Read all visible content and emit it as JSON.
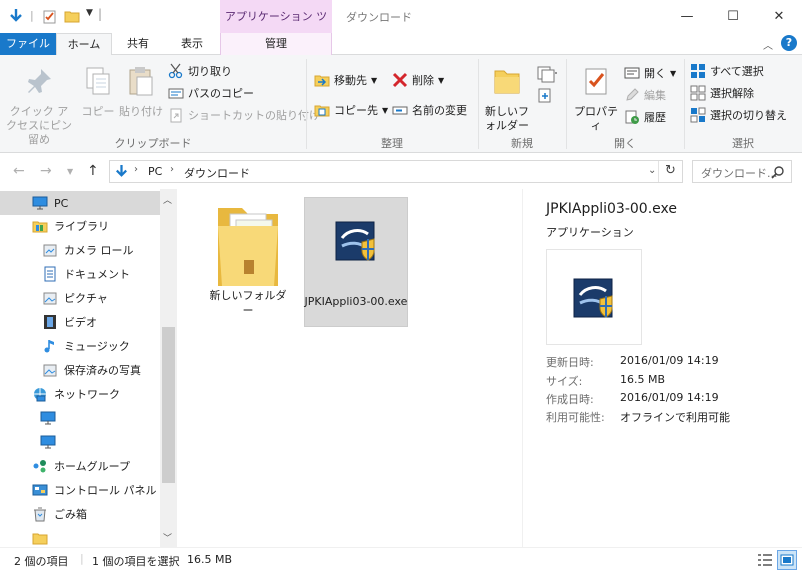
{
  "window": {
    "title": "ダウンロード",
    "context_tab_header": "アプリケーション ツール",
    "min_glyph": "—",
    "max_glyph": "☐",
    "close_glyph": "✕"
  },
  "ribbon_tabs": {
    "file": "ファイル",
    "home": "ホーム",
    "share": "共有",
    "view": "表示",
    "manage": "管理"
  },
  "clipboard": {
    "pin": "クイック アクセスにピン留め",
    "copy": "コピー",
    "paste": "貼り付け",
    "cut": "切り取り",
    "copy_path": "パスのコピー",
    "paste_shortcut": "ショートカットの貼り付け",
    "label": "クリップボード"
  },
  "organize": {
    "move_to": "移動先",
    "copy_to": "コピー先",
    "delete": "削除",
    "rename": "名前の変更",
    "label": "整理"
  },
  "new_group": {
    "new_folder": "新しいフォルダー",
    "label": "新規"
  },
  "open_group": {
    "properties": "プロパティ",
    "open": "開く",
    "edit": "編集",
    "history": "履歴",
    "label": "開く"
  },
  "select_group": {
    "select_all": "すべて選択",
    "select_none": "選択解除",
    "invert": "選択の切り替え",
    "label": "選択"
  },
  "address": {
    "crumbs": [
      "PC",
      "ダウンロード"
    ],
    "search_placeholder": "ダウンロード..."
  },
  "nav": {
    "pc": "PC",
    "libraries": "ライブラリ",
    "camera_roll": "カメラ ロール",
    "documents": "ドキュメント",
    "pictures": "ピクチャ",
    "videos": "ビデオ",
    "music": "ミュージック",
    "saved_pictures": "保存済みの写真",
    "network": "ネットワーク",
    "homegroup": "ホームグループ",
    "control_panel": "コントロール パネル",
    "recycle_bin": "ごみ箱"
  },
  "files": [
    {
      "name": "新しいフォルダー",
      "kind": "folder"
    },
    {
      "name": "JPKIAppli03-00.exe",
      "kind": "exe"
    }
  ],
  "preview": {
    "filename": "JPKIAppli03-00.exe",
    "type": "アプリケーション",
    "details": [
      {
        "k": "更新日時:",
        "v": "2016/01/09 14:19"
      },
      {
        "k": "サイズ:",
        "v": "16.5 MB"
      },
      {
        "k": "作成日時:",
        "v": "2016/01/09 14:19"
      },
      {
        "k": "利用可能性:",
        "v": "オフラインで利用可能"
      }
    ]
  },
  "status": {
    "count": "2 個の項目",
    "selected": "1 個の項目を選択",
    "size": "16.5 MB"
  },
  "colors": {
    "accent": "#1979ca",
    "tool_tab": "#f4d9f5",
    "selection": "#d9d9d9"
  }
}
